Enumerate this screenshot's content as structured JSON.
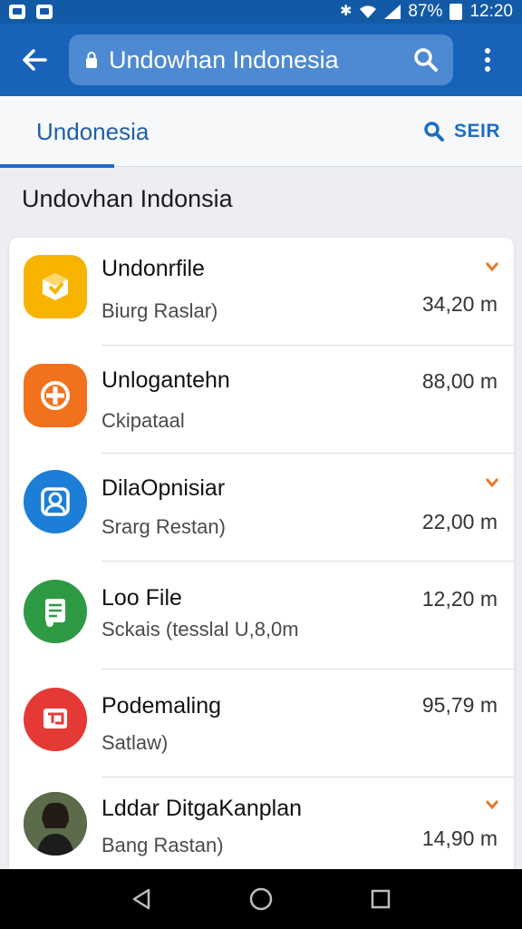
{
  "status_bar": {
    "battery": "87%",
    "time": "12:20"
  },
  "app_bar": {
    "search_text": "Undowhan Indonesia"
  },
  "tabs": {
    "active_label": "Undonesia",
    "search_label": "SEIR"
  },
  "section_title": "Undovhan Indonsia",
  "items": [
    {
      "title": "Undonrfile",
      "subtitle": "Biurg Raslar)",
      "size": "34,20 m",
      "icon": "package-icon",
      "color": "#f6b400"
    },
    {
      "title": "Unlogantehn",
      "subtitle": "Ckipataal",
      "size": "88,00 m",
      "icon": "plus-circle-icon",
      "color": "#f2711c"
    },
    {
      "title": "DilaOpnisiar",
      "subtitle": "Srarg Restan)",
      "size": "22,00 m",
      "icon": "contact-icon",
      "color": "#1c7ed6"
    },
    {
      "title": "Loo File",
      "subtitle": "Sckais (tesslal U,8,0m",
      "size": "12,20 m",
      "icon": "document-icon",
      "color": "#2e9a44"
    },
    {
      "title": "Podemaling",
      "subtitle": "Satlaw)",
      "size": "95,79 m",
      "icon": "chat-icon",
      "color": "#e53935"
    },
    {
      "title": "Lddar DitgaKanplan",
      "subtitle": "Bang Rastan)",
      "size": "14,90 m",
      "icon": "avatar-photo",
      "color": "#3b3a2e"
    }
  ],
  "colors": {
    "app_bar": "#1863b8",
    "accent": "#1e6cc4",
    "chevron": "#e5792b"
  }
}
